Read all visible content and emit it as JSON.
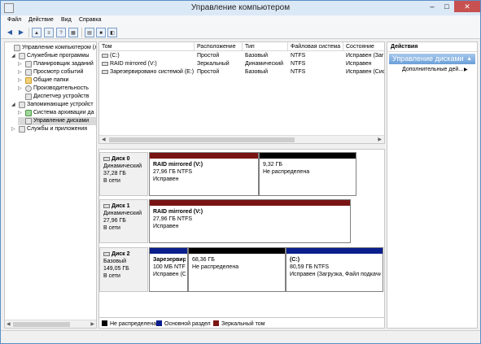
{
  "window": {
    "title": "Управление компьютером",
    "controls": {
      "minimize": "–",
      "maximize": "□",
      "close": "✕"
    }
  },
  "menu": [
    "Файл",
    "Действие",
    "Вид",
    "Справка"
  ],
  "toolbar": {
    "icons": [
      "back-arrow-icon",
      "forward-arrow-icon",
      "up-folder-icon",
      "properties-icon",
      "help-icon",
      "console-tree-icon",
      "export-icon",
      "connect-icon",
      "settings-icon"
    ]
  },
  "tree": [
    {
      "label": "Управление компьютером (л",
      "expander": "",
      "level": 0
    },
    {
      "label": "Служебные программы",
      "expander": "◢",
      "level": 1
    },
    {
      "label": "Планировщик заданий",
      "expander": "▷",
      "level": 2
    },
    {
      "label": "Просмотр событий",
      "expander": "▷",
      "level": 2
    },
    {
      "label": "Общие папки",
      "expander": "▷",
      "level": 2
    },
    {
      "label": "Производительность",
      "expander": "▷",
      "level": 2
    },
    {
      "label": "Диспетчер устройств",
      "expander": "",
      "level": 2
    },
    {
      "label": "Запоминающие устройст",
      "expander": "◢",
      "level": 1
    },
    {
      "label": "Система архивации да",
      "expander": "▷",
      "level": 2
    },
    {
      "label": "Управление дисками",
      "expander": "",
      "level": 2
    },
    {
      "label": "Службы и приложения",
      "expander": "▷",
      "level": 1
    }
  ],
  "volumes": {
    "columns": [
      "Том",
      "Расположение",
      "Тип",
      "Файловая система",
      "Состояние"
    ],
    "rows": [
      [
        "(C:)",
        "Простой",
        "Базовый",
        "NTFS",
        "Исправен (Загр"
      ],
      [
        "RAID mirrored (V:)",
        "Зеркальный",
        "Динамический",
        "NTFS",
        "Исправен"
      ],
      [
        "Зарезервировано системой (E:)",
        "Простой",
        "Базовый",
        "NTFS",
        "Исправен (Сист"
      ]
    ]
  },
  "disks": [
    {
      "name": "Диск 0",
      "type": "Динамический",
      "size": "37,28 ГБ",
      "status": "В сети",
      "partitions": [
        {
          "name": "RAID mirrored  (V:)",
          "detail": "27,96 ГБ NTFS",
          "status": "Исправен",
          "color": "#7a1414"
        },
        {
          "name": "",
          "detail": "9,32 ГБ",
          "status": "Не распределена",
          "color": "#000000"
        }
      ]
    },
    {
      "name": "Диск 1",
      "type": "Динамический",
      "size": "27,96 ГБ",
      "status": "В сети",
      "partitions": [
        {
          "name": "RAID mirrored  (V:)",
          "detail": "27,96 ГБ NTFS",
          "status": "Исправен",
          "color": "#7a1414"
        }
      ]
    },
    {
      "name": "Диск 2",
      "type": "Базовый",
      "size": "149,05 ГБ",
      "status": "В сети",
      "partitions": [
        {
          "name": "Зарезервир",
          "detail": "100 МБ NTFS",
          "status": "Исправен (С",
          "color": "#0a1e8c"
        },
        {
          "name": "",
          "detail": "68,36 ГБ",
          "status": "Не распределена",
          "color": "#000000"
        },
        {
          "name": "(C:)",
          "detail": "80,59 ГБ NTFS",
          "status": "Исправен (Загрузка, Файл подкачи",
          "color": "#0a1e8c"
        }
      ]
    }
  ],
  "legend": [
    {
      "label": "Не распределена",
      "color": "#000000"
    },
    {
      "label": "Основной раздел",
      "color": "#0a1e8c"
    },
    {
      "label": "Зеркальный том",
      "color": "#7a1414"
    }
  ],
  "actions": {
    "header": "Действия",
    "section": "Управление дисками",
    "items": [
      "Дополнительные дей..."
    ]
  }
}
